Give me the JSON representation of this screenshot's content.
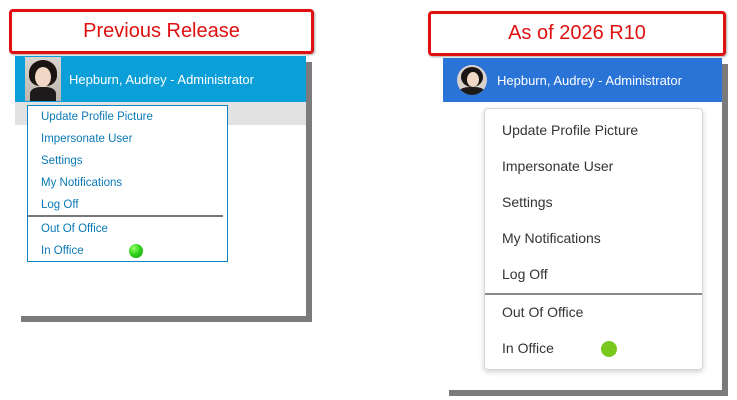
{
  "callouts": {
    "previous": "Previous Release",
    "current": "As of 2026 R10"
  },
  "user": {
    "display_name": "Hepburn, Audrey - Administrator"
  },
  "menu": {
    "items": [
      "Update Profile Picture",
      "Impersonate User",
      "Settings",
      "My Notifications",
      "Log Off"
    ],
    "status_items": [
      "Out Of Office",
      "In Office"
    ]
  },
  "colors": {
    "callout_red": "#e01010",
    "old_header_blue": "#0a9fd8",
    "old_link_blue": "#0a79b5",
    "new_header_blue": "#2a74d8",
    "status_green": "#78c81e"
  },
  "icons": {
    "avatar": "profile-photo",
    "status": "green-status-dot"
  }
}
